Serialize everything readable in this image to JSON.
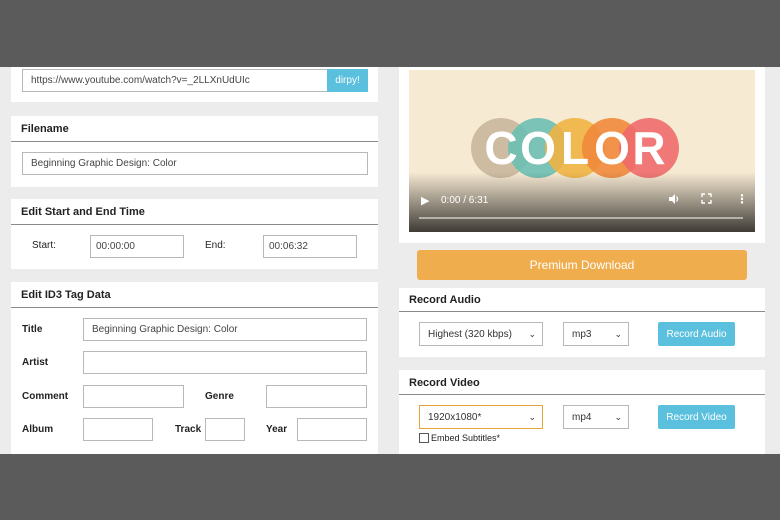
{
  "url_bar": {
    "value": "https://www.youtube.com/watch?v=_2LLXnUdUIc",
    "button_label": "dirpy!"
  },
  "filename": {
    "title": "Filename",
    "value": "Beginning Graphic Design: Color"
  },
  "trim": {
    "title": "Edit Start and End Time",
    "start_label": "Start:",
    "start_value": "00:00:00",
    "end_label": "End:",
    "end_value": "00:06:32"
  },
  "id3": {
    "title": "Edit ID3 Tag Data",
    "title_label": "Title",
    "title_value": "Beginning Graphic Design: Color",
    "artist_label": "Artist",
    "artist_value": "",
    "comment_label": "Comment",
    "comment_value": "",
    "genre_label": "Genre",
    "genre_value": "",
    "album_label": "Album",
    "album_value": "",
    "track_label": "Track",
    "track_value": "",
    "year_label": "Year",
    "year_value": ""
  },
  "video": {
    "logo_letters": [
      "C",
      "O",
      "L",
      "O",
      "R"
    ],
    "logo_colors": [
      "#c9b79c",
      "#6bbfb2",
      "#f0b443",
      "#ef8a3b",
      "#ee6b6b"
    ],
    "time": "0:00 / 6:31",
    "play_icon": "play-icon",
    "progress_fraction": 0.0
  },
  "premium": {
    "label": "Premium Download",
    "color": "#f0ad4e"
  },
  "audio": {
    "title": "Record Audio",
    "quality": "Highest (320 kbps)",
    "format": "mp3",
    "button_label": "Record Audio"
  },
  "rvideo": {
    "title": "Record Video",
    "resolution": "1920x1080*",
    "format": "mp4",
    "button_label": "Record Video",
    "subtitle_label": "Embed Subtitles*",
    "subtitle_checked": false
  }
}
